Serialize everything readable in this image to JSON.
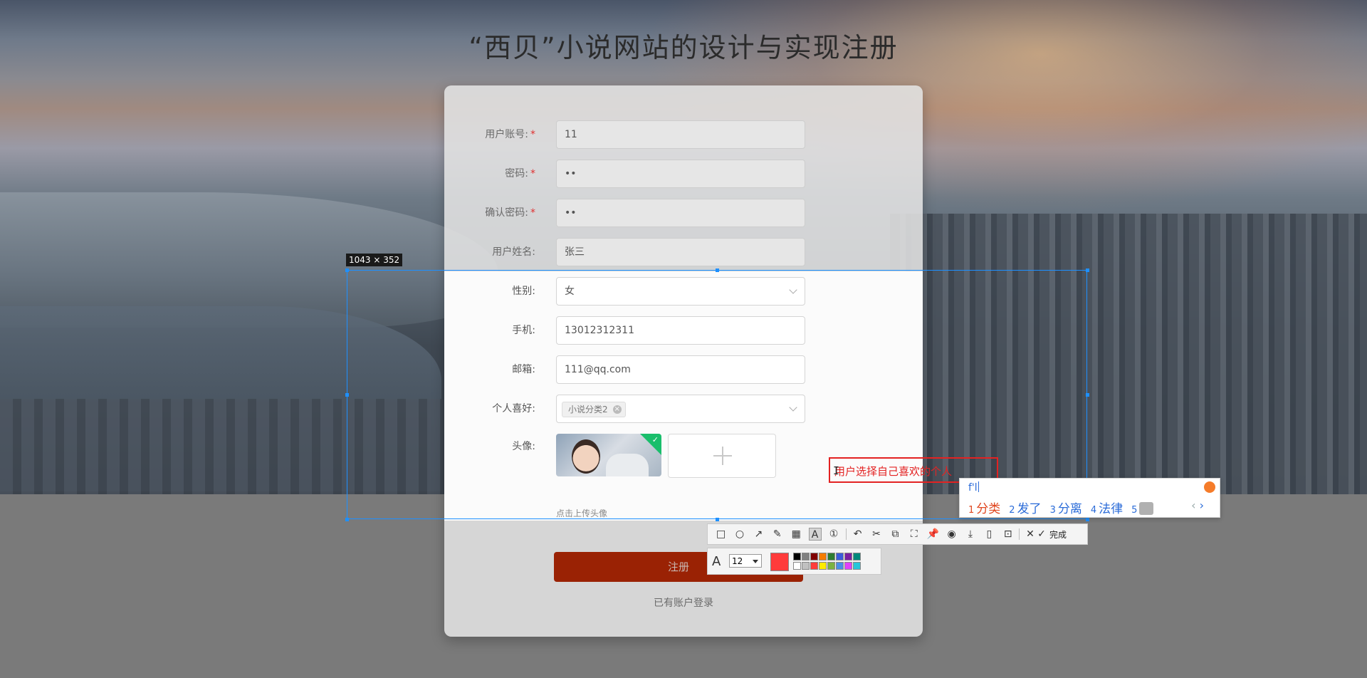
{
  "page": {
    "title": "“西贝”小说网站的设计与实现注册"
  },
  "form": {
    "username": {
      "label": "用户账号:",
      "value": "11",
      "required": true
    },
    "password": {
      "label": "密码:",
      "value": "••",
      "required": true
    },
    "confirm_password": {
      "label": "确认密码:",
      "value": "••",
      "required": true
    },
    "real_name": {
      "label": "用户姓名:",
      "value": "张三"
    },
    "gender": {
      "label": "性别:",
      "value": "女"
    },
    "phone": {
      "label": "手机:",
      "value": "13012312311"
    },
    "email": {
      "label": "邮箱:",
      "value": "111@qq.com"
    },
    "hobby": {
      "label": "个人喜好:",
      "tag": "小说分类2",
      "tag_close": "×"
    },
    "avatar": {
      "label": "头像:",
      "upload_tip": "点击上传头像",
      "check": "✓"
    },
    "required_mark": "*",
    "submit_label": "注册",
    "login_link": "已有账户登录"
  },
  "screenshot_tool": {
    "selection_size": "1043 × 352",
    "annotation_text": "用户选择自己喜欢的个人",
    "cursor": "I",
    "ime": {
      "input": "f'l",
      "candidates": [
        {
          "n": "1",
          "text": "分类"
        },
        {
          "n": "2",
          "text": "发了"
        },
        {
          "n": "3",
          "text": "分离"
        },
        {
          "n": "4",
          "text": "法律"
        },
        {
          "n": "5",
          "text": ""
        }
      ],
      "prev": "‹",
      "next": "›"
    },
    "toolbar": {
      "icons": [
        "rectangle-icon",
        "ellipse-icon",
        "arrow-icon",
        "pen-icon",
        "mosaic-icon",
        "text-icon",
        "number-icon",
        "undo-icon",
        "cut-icon",
        "ocr-icon",
        "scroll-capture-icon",
        "pin-icon",
        "record-icon",
        "download-icon",
        "long-screenshot-icon",
        "bookmark-icon",
        "close-icon",
        "check-icon"
      ],
      "glyphs": [
        "□",
        "○",
        "↗",
        "✎",
        "▦",
        "A",
        "①",
        "↶",
        "✂",
        "⧉",
        "⛶",
        "📌",
        "◉",
        "⤓",
        "▯",
        "⊡",
        "✕",
        "✓"
      ],
      "done_label": "完成"
    },
    "text_options": {
      "font_icon": "A",
      "font_size": "12",
      "current_color": "#ff3b3b",
      "palette": [
        "#000000",
        "#808080",
        "#800000",
        "#f57c00",
        "#2e7d32",
        "#3b5bdb",
        "#7b1fa2",
        "#00897b",
        "#ffffff",
        "#c0c0c0",
        "#ff3b3b",
        "#ffeb00",
        "#7cb342",
        "#4a8fe7",
        "#e040fb",
        "#26c6da"
      ]
    }
  }
}
